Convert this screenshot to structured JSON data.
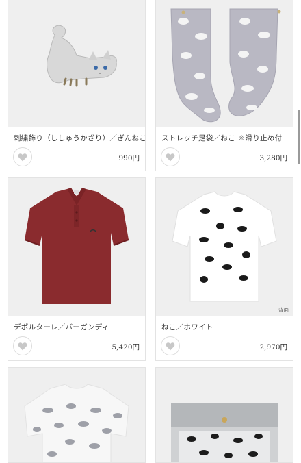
{
  "products": [
    {
      "title": "刺繍飾り（ししゅうかざり）／ぎんねこ",
      "price": "990円",
      "favorite_icon": "heart-icon"
    },
    {
      "title": "ストレッチ足袋／ねこ ※滑り止め付",
      "price": "3,280円",
      "favorite_icon": "heart-icon"
    },
    {
      "title": "デポルターレ／バーガンディ",
      "price": "5,420円",
      "favorite_icon": "heart-icon"
    },
    {
      "title": "ねこ／ホワイト",
      "price": "2,970円",
      "favorite_icon": "heart-icon",
      "badge": "背面"
    },
    {
      "title": "",
      "price": ""
    },
    {
      "title": "",
      "price": ""
    }
  ],
  "colors": {
    "image_bg": "#efefef",
    "polo": "#8a2b2e",
    "heart": "#c8c8c8"
  }
}
